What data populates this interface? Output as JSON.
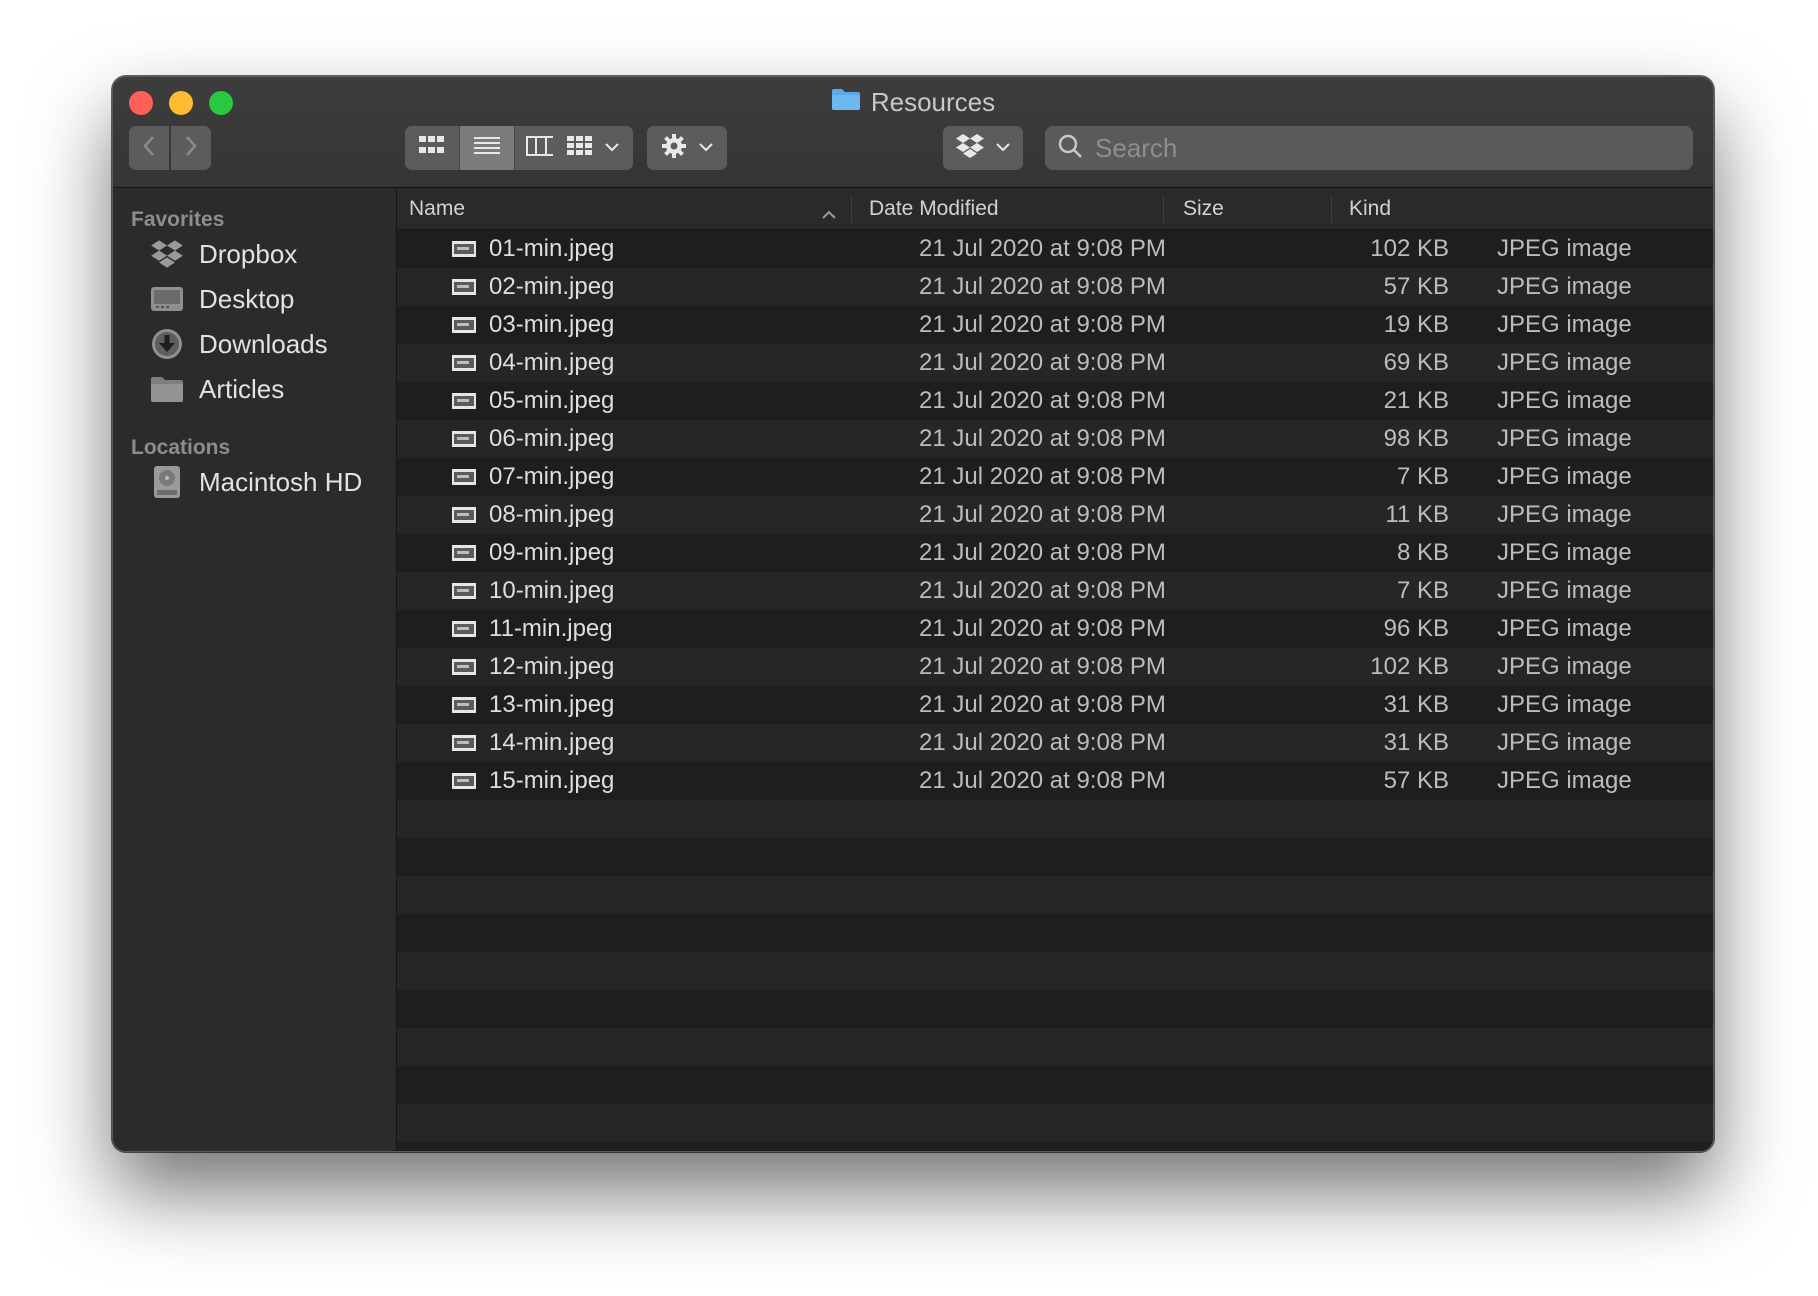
{
  "window": {
    "title": "Resources"
  },
  "toolbar": {
    "back_icon": "chevron-left-icon",
    "forward_icon": "chevron-right-icon",
    "view_modes": [
      "icon-view",
      "list-view",
      "column-view",
      "gallery-view"
    ],
    "active_view": "list-view",
    "group_icon": "grid-icon",
    "action_icon": "gear-icon",
    "dropbox_icon": "dropbox-icon",
    "search_placeholder": "Search"
  },
  "sidebar": {
    "favorites_label": "Favorites",
    "favorites": [
      {
        "label": "Dropbox",
        "icon": "dropbox-icon"
      },
      {
        "label": "Desktop",
        "icon": "desktop-icon"
      },
      {
        "label": "Downloads",
        "icon": "downloads-icon"
      },
      {
        "label": "Articles",
        "icon": "folder-icon"
      }
    ],
    "locations_label": "Locations",
    "locations": [
      {
        "label": "Macintosh HD",
        "icon": "hard-drive-icon"
      }
    ]
  },
  "columns": {
    "name": "Name",
    "date": "Date Modified",
    "size": "Size",
    "kind": "Kind"
  },
  "files": [
    {
      "name": "01-min.jpeg",
      "date": "21 Jul 2020 at 9:08 PM",
      "size": "102 KB",
      "kind": "JPEG image"
    },
    {
      "name": "02-min.jpeg",
      "date": "21 Jul 2020 at 9:08 PM",
      "size": "57 KB",
      "kind": "JPEG image"
    },
    {
      "name": "03-min.jpeg",
      "date": "21 Jul 2020 at 9:08 PM",
      "size": "19 KB",
      "kind": "JPEG image"
    },
    {
      "name": "04-min.jpeg",
      "date": "21 Jul 2020 at 9:08 PM",
      "size": "69 KB",
      "kind": "JPEG image"
    },
    {
      "name": "05-min.jpeg",
      "date": "21 Jul 2020 at 9:08 PM",
      "size": "21 KB",
      "kind": "JPEG image"
    },
    {
      "name": "06-min.jpeg",
      "date": "21 Jul 2020 at 9:08 PM",
      "size": "98 KB",
      "kind": "JPEG image"
    },
    {
      "name": "07-min.jpeg",
      "date": "21 Jul 2020 at 9:08 PM",
      "size": "7 KB",
      "kind": "JPEG image"
    },
    {
      "name": "08-min.jpeg",
      "date": "21 Jul 2020 at 9:08 PM",
      "size": "11 KB",
      "kind": "JPEG image"
    },
    {
      "name": "09-min.jpeg",
      "date": "21 Jul 2020 at 9:08 PM",
      "size": "8 KB",
      "kind": "JPEG image"
    },
    {
      "name": "10-min.jpeg",
      "date": "21 Jul 2020 at 9:08 PM",
      "size": "7 KB",
      "kind": "JPEG image"
    },
    {
      "name": "11-min.jpeg",
      "date": "21 Jul 2020 at 9:08 PM",
      "size": "96 KB",
      "kind": "JPEG image"
    },
    {
      "name": "12-min.jpeg",
      "date": "21 Jul 2020 at 9:08 PM",
      "size": "102 KB",
      "kind": "JPEG image"
    },
    {
      "name": "13-min.jpeg",
      "date": "21 Jul 2020 at 9:08 PM",
      "size": "31 KB",
      "kind": "JPEG image"
    },
    {
      "name": "14-min.jpeg",
      "date": "21 Jul 2020 at 9:08 PM",
      "size": "31 KB",
      "kind": "JPEG image"
    },
    {
      "name": "15-min.jpeg",
      "date": "21 Jul 2020 at 9:08 PM",
      "size": "57 KB",
      "kind": "JPEG image"
    }
  ],
  "colors": {
    "close": "#fe5f57",
    "minimize": "#febc2e",
    "zoom": "#28c840",
    "folder": "#5aa9e6",
    "window_bg": "#1e1e1e",
    "sidebar_bg": "#2b2b2b"
  }
}
